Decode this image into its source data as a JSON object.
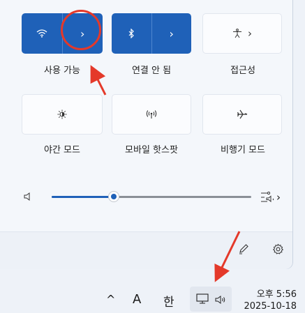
{
  "quick_settings": {
    "wifi": {
      "label": "사용 가능",
      "icon": "wifi-icon",
      "expand_icon": "chevron-right-icon",
      "active": true
    },
    "bluetooth": {
      "label": "연결 안 됨",
      "icon": "bluetooth-icon",
      "expand_icon": "chevron-right-icon",
      "active": true
    },
    "accessibility": {
      "label": "접근성",
      "icon": "accessibility-icon",
      "expand_icon": "chevron-right-icon"
    },
    "night_light": {
      "label": "야간 모드",
      "icon": "brightness-icon"
    },
    "hotspot": {
      "label": "모바일 핫스팟",
      "icon": "hotspot-icon"
    },
    "airplane": {
      "label": "비행기 모드",
      "icon": "airplane-icon"
    }
  },
  "volume": {
    "level": 0.31,
    "speaker_icon": "speaker-icon",
    "output_icon": "audio-output-icon"
  },
  "footer": {
    "edit_icon": "pencil-icon",
    "settings_icon": "gear-icon"
  },
  "taskbar": {
    "chevron": "^",
    "input_mode": "A",
    "ime": "한",
    "time": "오후 5:56",
    "date": "2025-10-18"
  },
  "colors": {
    "accent": "#1f61b8",
    "annotation": "#e4392a"
  }
}
